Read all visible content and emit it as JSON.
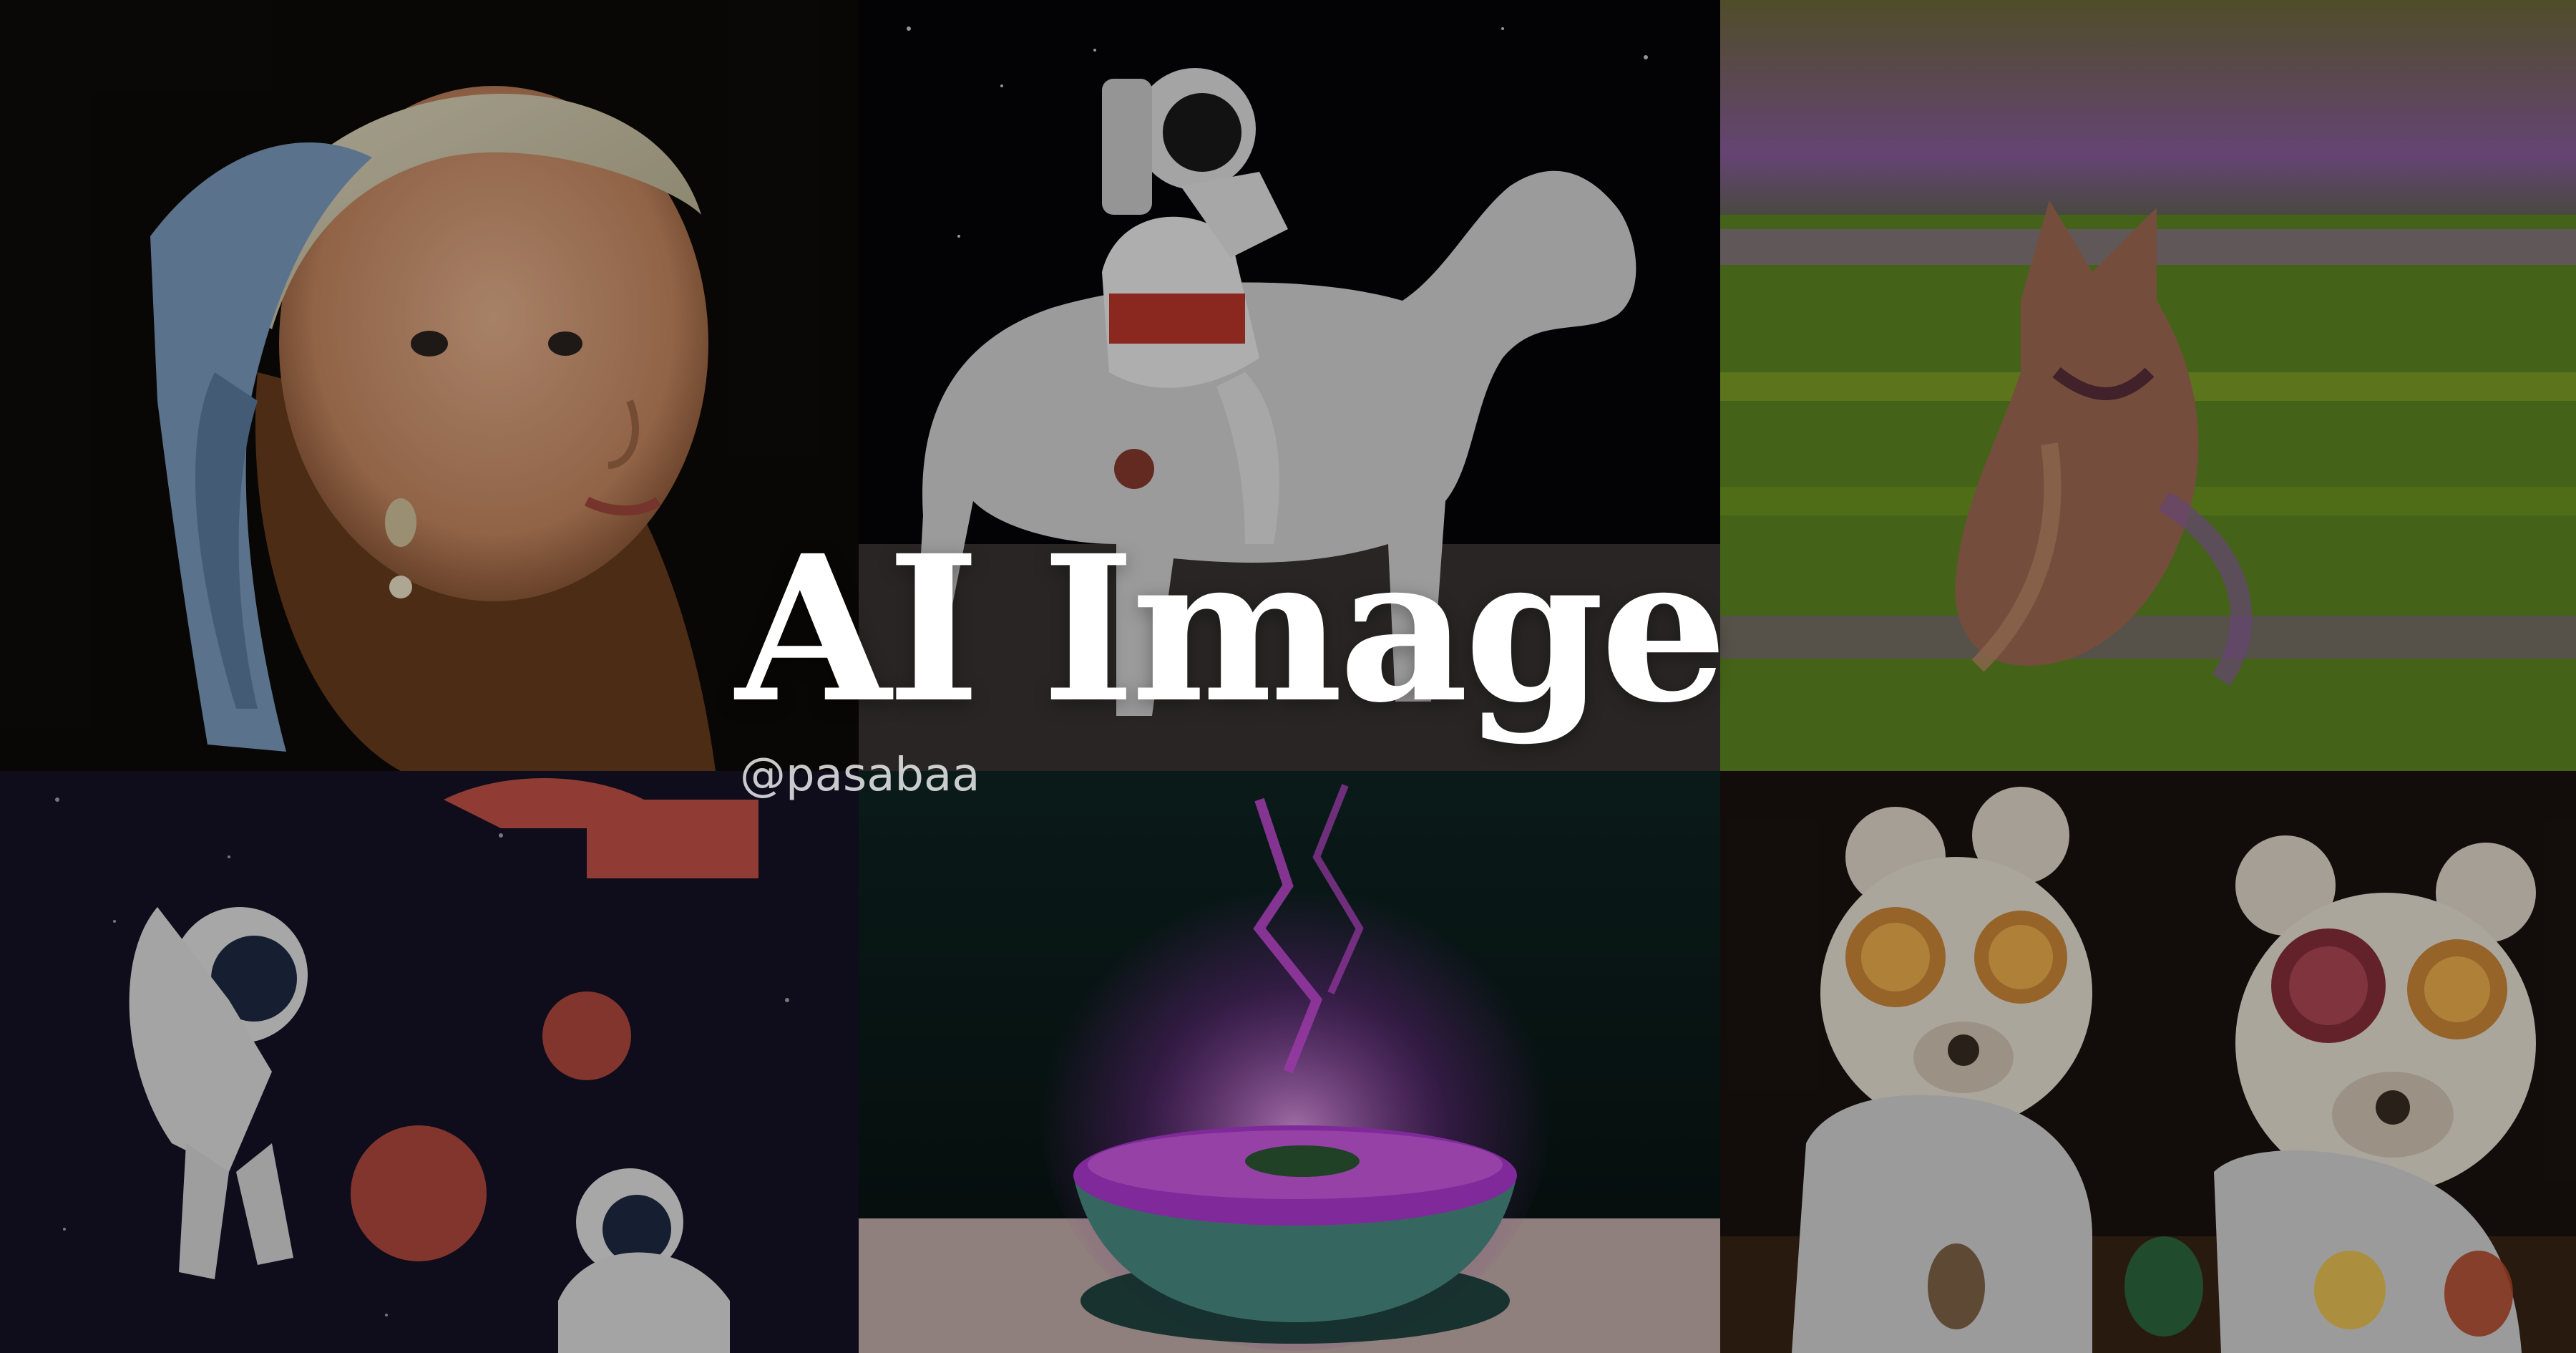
{
  "title": "AI Image",
  "handle": "@pasabaa",
  "colors": {
    "text": "#ffffff",
    "handle": "#c9c9c9"
  },
  "tiles": [
    "Portrait painting of a girl with a blue headscarf and pearl earring",
    "Astronaut riding a white horse in space",
    "Impressionist fox in a colorful meadow",
    "Cartoon astronauts floating among planets",
    "Glowing pink soup bowl with purple lightning",
    "Teddy bears in goggles doing a chemistry experiment"
  ]
}
